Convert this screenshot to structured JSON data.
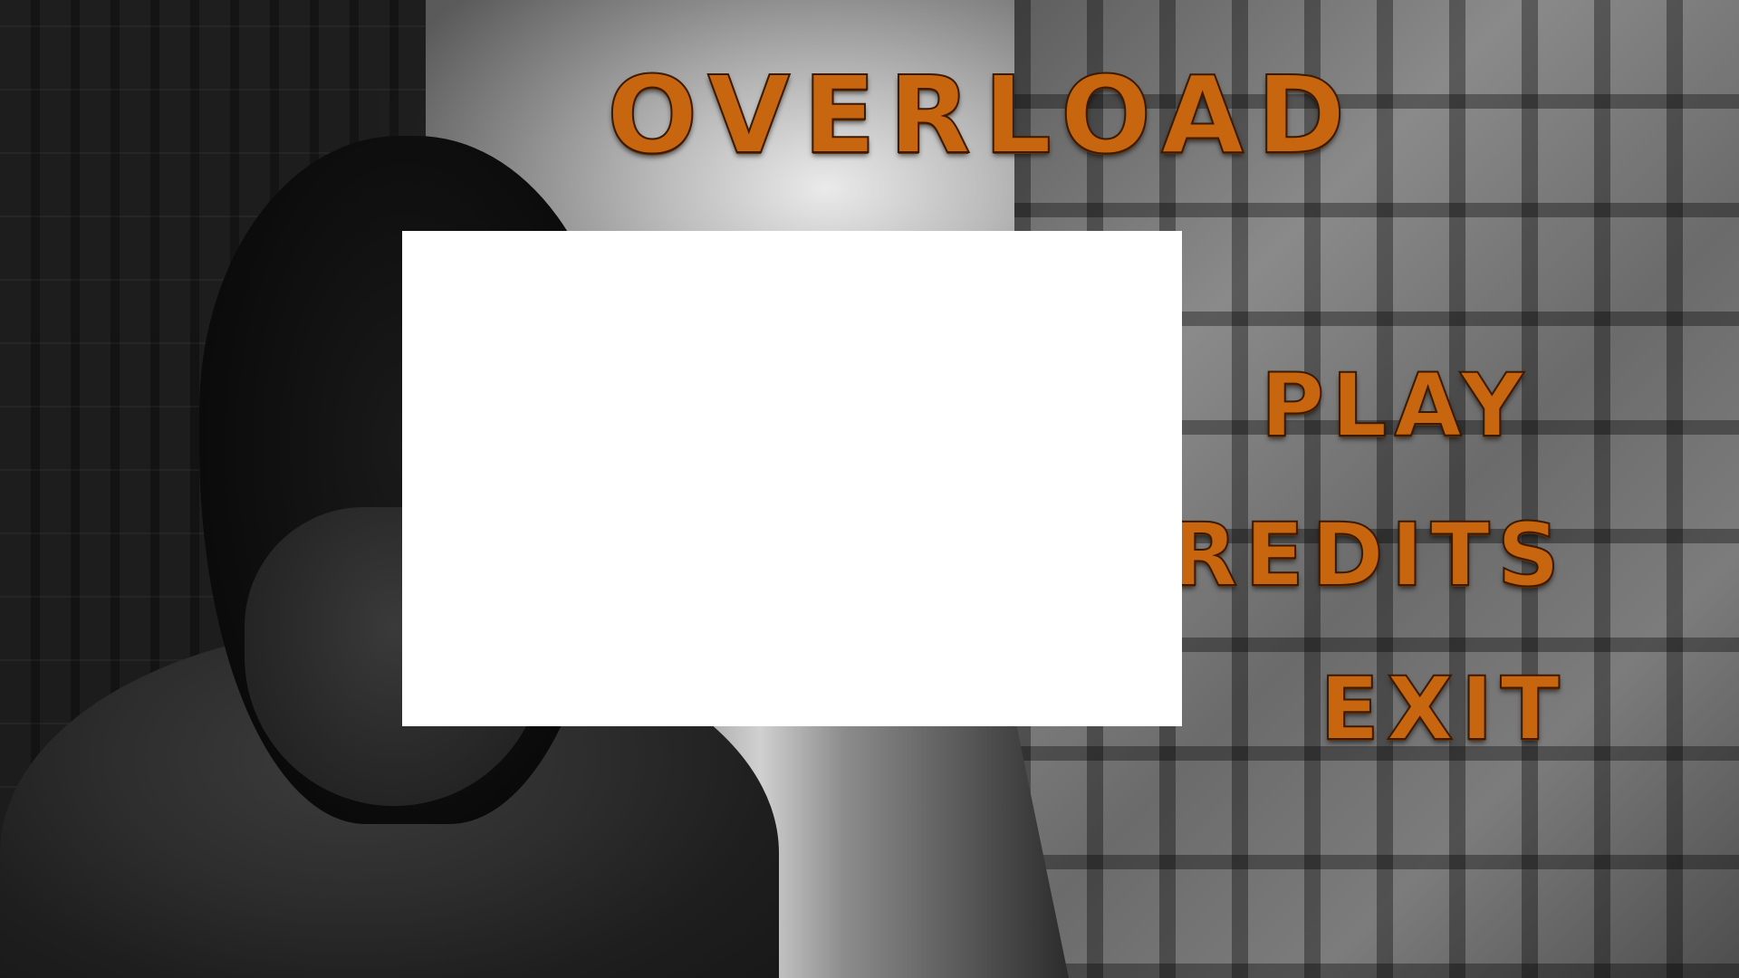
{
  "title": "OVERLOAD",
  "menu": {
    "play": "PLAY",
    "credits": "CREDITS",
    "exit": "EXIT"
  },
  "colors": {
    "text_accent": "#c8650f",
    "panel": "#ffffff"
  }
}
